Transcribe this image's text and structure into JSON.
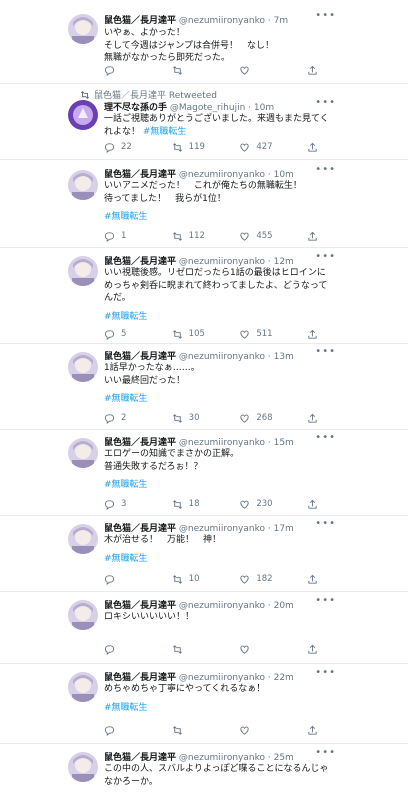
{
  "timeline": {
    "tweets": [
      {
        "name": "鼠色猫／長月達平",
        "handle": "@nezumiironyanko",
        "time": "7m",
        "lines": [
          "いやぁ、よかった！",
          "そして今週はジャンプは合併号！　なし！",
          "無職がなかったら即死だった。"
        ],
        "hashtag": "",
        "reply": "",
        "retweets": "",
        "likes": ""
      },
      {
        "retweeted_by": "鼠色猫／長月達平 Retweeted",
        "name": "理不尽な孫の手",
        "handle": "@Magote_rihujin",
        "time": "10m",
        "lines": [
          "一話ご視聴ありがとうございました。来週もまた見てく",
          "れよな！"
        ],
        "inline_tag": "#無職転生",
        "hashtag": "",
        "reply": "22",
        "retweets": "119",
        "likes": "427"
      },
      {
        "name": "鼠色猫／長月達平",
        "handle": "@nezumiironyanko",
        "time": "10m",
        "lines": [
          "いいアニメだった！　これが俺たちの無職転生！",
          "待ってました！　我らが1位！"
        ],
        "hashtag": "#無職転生",
        "reply": "1",
        "retweets": "112",
        "likes": "455"
      },
      {
        "name": "鼠色猫／長月達平",
        "handle": "@nezumiironyanko",
        "time": "12m",
        "lines": [
          "いい視聴後感。リゼロだったら1話の最後はヒロインに",
          "めっちゃ剣呑に睨まれて終わってましたよ、どうなって",
          "んだ。"
        ],
        "hashtag": "#無職転生",
        "reply": "5",
        "retweets": "105",
        "likes": "511"
      },
      {
        "name": "鼠色猫／長月達平",
        "handle": "@nezumiironyanko",
        "time": "13m",
        "lines": [
          "1話早かったなぁ……。",
          "いい最終回だった！"
        ],
        "hashtag": "#無職転生",
        "reply": "2",
        "retweets": "30",
        "likes": "268"
      },
      {
        "name": "鼠色猫／長月達平",
        "handle": "@nezumiironyanko",
        "time": "15m",
        "lines": [
          "エロゲーの知識でまさかの正解。",
          "普通失敗するだろぉ！？"
        ],
        "hashtag": "#無職転生",
        "reply": "3",
        "retweets": "18",
        "likes": "230"
      },
      {
        "name": "鼠色猫／長月達平",
        "handle": "@nezumiironyanko",
        "time": "17m",
        "lines": [
          "木が治せる！　万能！　神！"
        ],
        "hashtag": "#無職転生",
        "reply": "",
        "retweets": "10",
        "likes": "182"
      },
      {
        "name": "鼠色猫／長月達平",
        "handle": "@nezumiironyanko",
        "time": "20m",
        "lines": [
          "ロキシいいいいい！！"
        ],
        "hashtag": "",
        "reply": "",
        "retweets": "",
        "likes": ""
      },
      {
        "name": "鼠色猫／長月達平",
        "handle": "@nezumiironyanko",
        "time": "22m",
        "lines": [
          "めちゃめちゃ丁寧にやってくれるなぁ！"
        ],
        "hashtag": "#無職転生",
        "reply": "",
        "retweets": "",
        "likes": ""
      },
      {
        "name": "鼠色猫／長月達平",
        "handle": "@nezumiironyanko",
        "time": "25m",
        "lines": [
          "この中の人、スバルよりよっぽど喋ることになるんじゃ",
          "なかろーか。"
        ],
        "hashtag": "",
        "reply": "",
        "retweets": "",
        "likes": ""
      }
    ]
  },
  "icons": {
    "more": "more-icon",
    "reply": "reply-icon",
    "retweet": "retweet-icon",
    "like": "heart-icon",
    "share": "share-icon"
  },
  "colors": {
    "accent": "#1da1f2",
    "muted": "#657786",
    "text": "#14171a",
    "divider": "#e6ecf0"
  }
}
